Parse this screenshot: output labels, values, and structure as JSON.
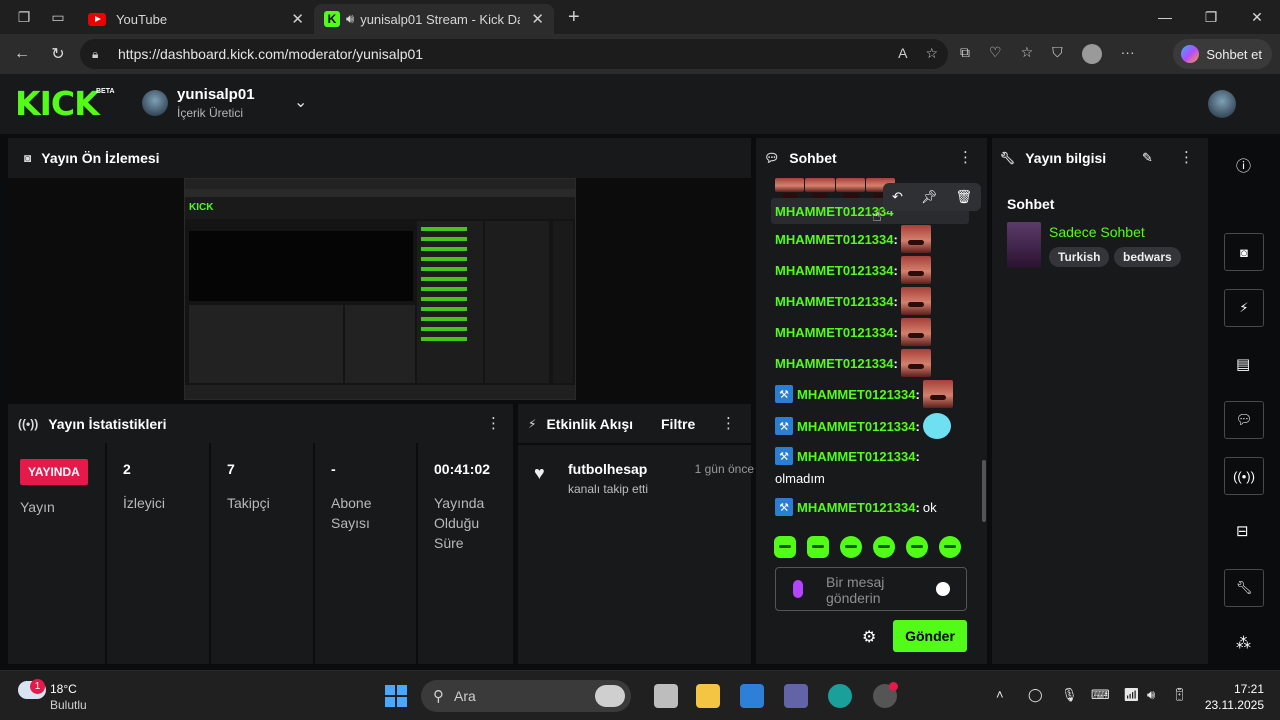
{
  "browser": {
    "tabs": [
      {
        "title": "YouTube",
        "active": false
      },
      {
        "title": "yunisalp01 Stream - Kick Da",
        "active": true
      }
    ],
    "url": "https://dashboard.kick.com/moderator/yunisalp01",
    "copilot_label": "Sohbet et"
  },
  "header": {
    "logo": "KICK",
    "logo_badge": "BETA",
    "channel_name": "yunisalp01",
    "channel_role": "İçerik Üretici"
  },
  "preview": {
    "title": "Yayın Ön İzlemesi"
  },
  "stats": {
    "title": "Yayın İstatistikleri",
    "live_badge": "YAYINDA",
    "cells": [
      {
        "value": "",
        "label": "Yayın"
      },
      {
        "value": "2",
        "label": "İzleyici"
      },
      {
        "value": "7",
        "label": "Takipçi"
      },
      {
        "value": "-",
        "label": "Abone Sayısı"
      },
      {
        "value": "00:41:02",
        "label": "Yayında Olduğu Süre"
      }
    ]
  },
  "activity": {
    "title": "Etkinlik Akışı",
    "filter_label": "Filtre",
    "items": [
      {
        "user": "futbolhesap",
        "desc": "kanalı takip etti",
        "time": "1 gün önce"
      }
    ]
  },
  "chat": {
    "title": "Sohbet",
    "messages": [
      {
        "user": "MHAMMET0121334",
        "text": "",
        "emote": "face",
        "mod": false,
        "highlight": true
      },
      {
        "user": "MHAMMET0121334",
        "text": "",
        "emote": "face",
        "mod": false
      },
      {
        "user": "MHAMMET0121334",
        "text": "",
        "emote": "face",
        "mod": false
      },
      {
        "user": "MHAMMET0121334",
        "text": "",
        "emote": "face",
        "mod": false
      },
      {
        "user": "MHAMMET0121334",
        "text": "",
        "emote": "face",
        "mod": false
      },
      {
        "user": "MHAMMET0121334",
        "text": "",
        "emote": "face",
        "mod": false
      },
      {
        "user": "MHAMMET0121334",
        "text": "",
        "emote": "face",
        "mod": true
      },
      {
        "user": "MHAMMET0121334",
        "text": "",
        "emote": "blue",
        "mod": true
      },
      {
        "user": "MHAMMET0121334",
        "text": "olmadım",
        "emote": "",
        "mod": true
      },
      {
        "user": "MHAMMET0121334",
        "text": "ok",
        "emote": "",
        "mod": true
      }
    ],
    "input_placeholder": "Bir mesaj gönderin",
    "send_label": "Gönder"
  },
  "info": {
    "title": "Yayın bilgisi",
    "subtitle": "Sohbet",
    "category": "Sadece Sohbet",
    "tags": [
      "Turkish",
      "bedwars"
    ]
  },
  "taskbar": {
    "weather_temp": "18°C",
    "weather_desc": "Bulutlu",
    "weather_badge": "1",
    "search_placeholder": "Ara",
    "time": "17:21",
    "date": "23.11.2025"
  },
  "colors": {
    "kick_green": "#53fc18",
    "live_red": "#e5194a",
    "panel_bg": "#18191b",
    "page_bg": "#0b0c0e"
  }
}
